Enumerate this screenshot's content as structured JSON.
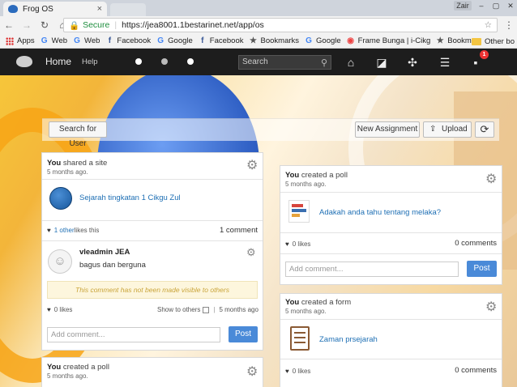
{
  "browser": {
    "tab_title": "Frog OS",
    "tab_close": "×",
    "window_user": "Zair",
    "window_min": "–",
    "window_max": "▢",
    "window_close": "✕",
    "secure_label": "Secure",
    "url": "https://jea8001.1bestarinet.net/app/os",
    "bookmarks": [
      {
        "icon": "apps",
        "label": "Apps"
      },
      {
        "icon": "G",
        "label": "Web"
      },
      {
        "icon": "G",
        "label": "Web"
      },
      {
        "icon": "f",
        "label": "Facebook"
      },
      {
        "icon": "G",
        "label": "Google"
      },
      {
        "icon": "f",
        "label": "Facebook"
      },
      {
        "icon": "★",
        "label": "Bookmarks"
      },
      {
        "icon": "G",
        "label": "Google"
      },
      {
        "icon": "◉",
        "label": "Frame Bunga | i-Cikg"
      },
      {
        "icon": "★",
        "label": "Bookmarks"
      }
    ],
    "other_bookmarks": "Other bo"
  },
  "frog": {
    "home": "Home",
    "help": "Help",
    "search_placeholder": "Search",
    "notification_count": "1"
  },
  "toolbar": {
    "search_user": "Search for User",
    "new_assignment": "New Assignment",
    "upload": "Upload"
  },
  "left": {
    "card1": {
      "user": "You",
      "action": " shared a site",
      "time": "5 months ago.",
      "site_title": "Sejarah tingkatan 1 Cikgu Zul",
      "likes_link": "1 other",
      "likes_suffix": " likes this",
      "comment_count": "1 comment",
      "comment_author": "vleadmin JEA",
      "comment_text": "bagus dan berguna",
      "comment_notice": "This comment has not been made visible to others",
      "comment_likes": "0 likes",
      "show_to_others": "Show to others",
      "comment_time": "5 months ago",
      "add_comment": "Add comment...",
      "post": "Post"
    },
    "card2": {
      "user": "You",
      "action": " created a poll",
      "time": "5 months ago."
    }
  },
  "right": {
    "card1": {
      "user": "You",
      "action": " created a poll",
      "time": "5 months ago.",
      "title": "Adakah anda tahu tentang melaka?",
      "likes": "0 likes",
      "comments": "0 comments",
      "add_comment": "Add comment...",
      "post": "Post"
    },
    "card2": {
      "user": "You",
      "action": " created a form",
      "time": "5 months ago.",
      "title": "Zaman prsejarah",
      "likes": "0 likes",
      "comments": "0 comments"
    }
  },
  "colors": {
    "frog_bar": "#1d1d1d",
    "link": "#1e6fb4",
    "post_button": "#4a8ad8",
    "notice_bg": "#fdf6dd"
  }
}
